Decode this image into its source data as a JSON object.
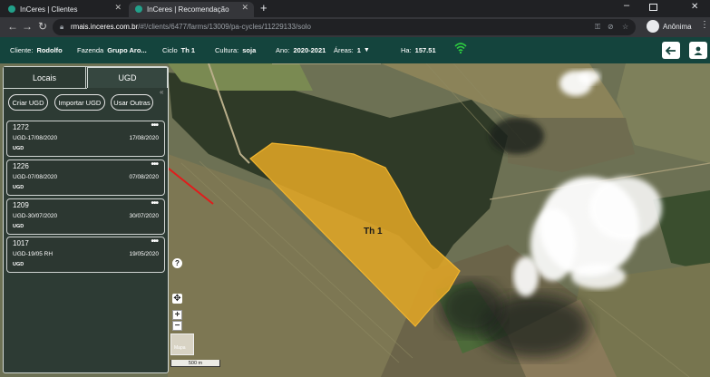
{
  "browser": {
    "tabs": [
      {
        "title": "InCeres | Clientes",
        "active": false
      },
      {
        "title": "InCeres | Recomendação",
        "active": true
      }
    ],
    "url_host": "rmais.inceres.com.br",
    "url_path": "/#!/clients/6477/farms/13009/pa-cycles/11229133/solo",
    "profile_label": "Anônima"
  },
  "header": {
    "cliente_label": "Cliente:",
    "cliente_value": "Rodolfo",
    "fazenda_label": "Fazenda",
    "fazenda_value": "Grupo Aro...",
    "ciclo_label": "Ciclo",
    "ciclo_value": "Th 1",
    "cultura_label": "Cultura:",
    "cultura_value": "soja",
    "ano_label": "Ano:",
    "ano_value": "2020-2021",
    "areas_label": "Áreas:",
    "areas_value": "1",
    "ha_label": "Ha:",
    "ha_value": "157.51",
    "accent_color": "#14443d"
  },
  "panel": {
    "tabs": [
      {
        "label": "Locais",
        "active": false
      },
      {
        "label": "UGD",
        "active": true
      }
    ],
    "buttons": {
      "criar": "Criar UGD",
      "importar": "Importar UGD",
      "usar": "Usar Outras"
    },
    "cards": [
      {
        "id": "1272",
        "name": "UGD-17/08/2020",
        "date": "17/08/2020",
        "tag": "UGD"
      },
      {
        "id": "1226",
        "name": "UGD-07/08/2020",
        "date": "07/08/2020",
        "tag": "UGD"
      },
      {
        "id": "1209",
        "name": "UGD-30/07/2020",
        "date": "30/07/2020",
        "tag": "UGD"
      },
      {
        "id": "1017",
        "name": "UGD-19/05 RH",
        "date": "19/05/2020",
        "tag": "UGD"
      }
    ]
  },
  "map": {
    "field_label": "Th 1",
    "field_color": "#e0a526",
    "scale_label": "500 m",
    "help_label": "?",
    "zoom_in": "+",
    "zoom_out": "−",
    "layer_thumb_label": "Mapa"
  }
}
